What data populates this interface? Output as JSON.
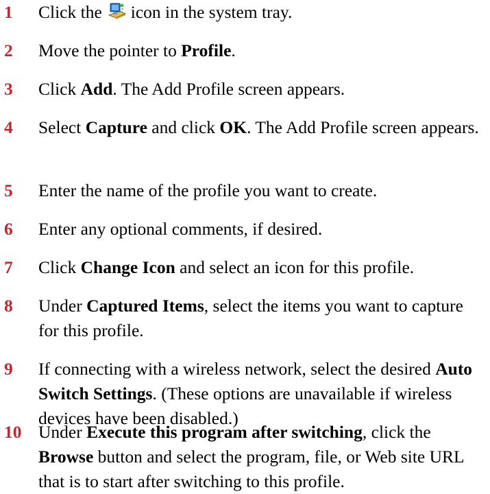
{
  "accent_color": "#c1272d",
  "steps": [
    {
      "number": "1",
      "parts": [
        {
          "t": "Click the"
        },
        {
          "icon": "network-profile-icon"
        },
        {
          "t": "icon in the system tray."
        }
      ]
    },
    {
      "number": "2",
      "parts": [
        {
          "t": "Move the pointer to "
        },
        {
          "b": "Profile"
        },
        {
          "t": "."
        }
      ]
    },
    {
      "number": "3",
      "parts": [
        {
          "t": "Click "
        },
        {
          "b": "Add"
        },
        {
          "t": ". The Add Profile screen appears."
        }
      ]
    },
    {
      "number": "4",
      "parts": [
        {
          "t": "Select "
        },
        {
          "b": "Capture"
        },
        {
          "t": " and click "
        },
        {
          "b": "OK"
        },
        {
          "t": ". The Add Profile screen appears."
        }
      ]
    },
    {
      "number": "5",
      "parts": [
        {
          "t": "Enter the name of the profile you want to create."
        }
      ]
    },
    {
      "number": "6",
      "parts": [
        {
          "t": "Enter any optional comments, if desired."
        }
      ]
    },
    {
      "number": "7",
      "parts": [
        {
          "t": "Click "
        },
        {
          "b": "Change Icon"
        },
        {
          "t": " and select an icon for this profile."
        }
      ]
    },
    {
      "number": "8",
      "parts": [
        {
          "t": "Under "
        },
        {
          "b": "Captured Items"
        },
        {
          "t": ", select the items you want to capture for this profile."
        }
      ]
    },
    {
      "number": "9",
      "parts": [
        {
          "t": "If connecting with a wireless network, select the desired "
        },
        {
          "b": "Auto Switch Settings"
        },
        {
          "t": ". (These options are unavailable if wireless devices have been disabled.)"
        }
      ]
    },
    {
      "number": "10",
      "parts": [
        {
          "t": "Under "
        },
        {
          "b": "Execute this program after switching"
        },
        {
          "t": ", click the "
        },
        {
          "b": "Browse"
        },
        {
          "t": " button and select the program, file, or Web site URL that is to start after switching to this profile."
        }
      ]
    }
  ]
}
